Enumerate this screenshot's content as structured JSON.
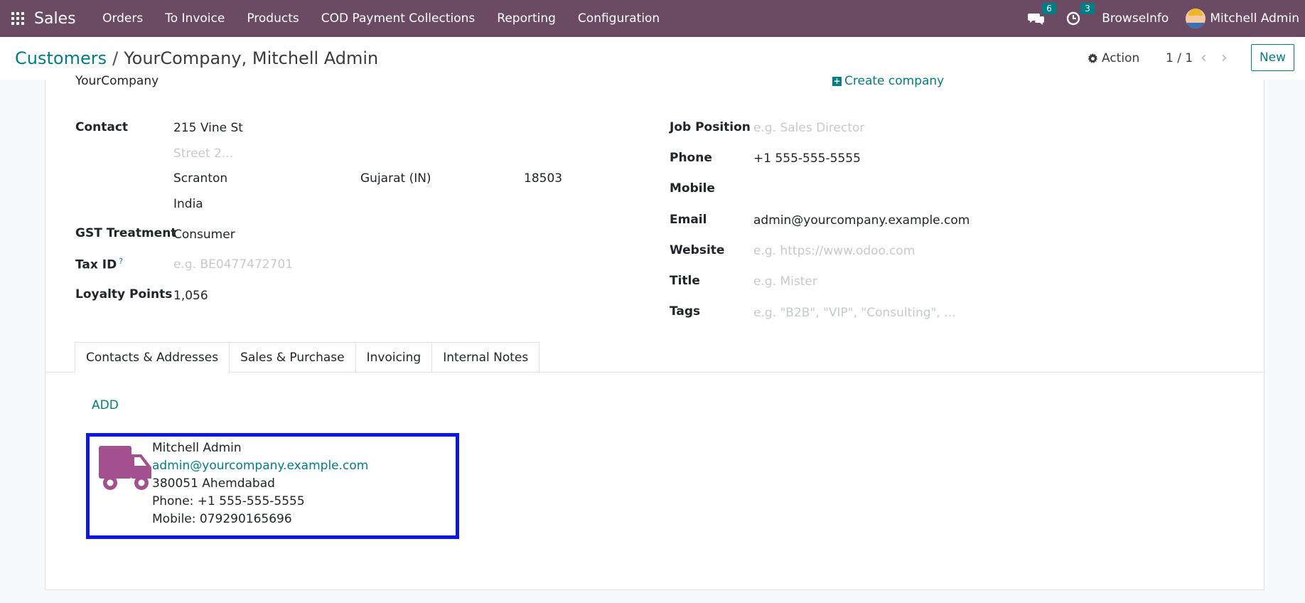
{
  "navbar": {
    "app_name": "Sales",
    "menu": [
      "Orders",
      "To Invoice",
      "Products",
      "COD Payment Collections",
      "Reporting",
      "Configuration"
    ],
    "messages_count": "6",
    "activities_count": "3",
    "company": "BrowseInfo",
    "user": "Mitchell Admin"
  },
  "control": {
    "breadcrumb_parent": "Customers",
    "breadcrumb_sep": "/",
    "breadcrumb_current": "YourCompany, Mitchell Admin",
    "action_label": "Action",
    "pager": "1 / 1",
    "new_label": "New"
  },
  "form": {
    "company_name": "YourCompany",
    "create_company": "Create company",
    "contact_label": "Contact",
    "street": "215 Vine St",
    "street2_placeholder": "Street 2...",
    "city": "Scranton",
    "state": "Gujarat (IN)",
    "zip": "18503",
    "country": "India",
    "gst_label": "GST Treatment",
    "gst_value": "Consumer",
    "taxid_label": "Tax ID",
    "taxid_help": "?",
    "taxid_placeholder": "e.g. BE0477472701",
    "loyalty_label": "Loyalty Points",
    "loyalty_value": "1,056",
    "job_label": "Job Position",
    "job_placeholder": "e.g. Sales Director",
    "phone_label": "Phone",
    "phone_value": "+1 555-555-5555",
    "mobile_label": "Mobile",
    "email_label": "Email",
    "email_value": "admin@yourcompany.example.com",
    "website_label": "Website",
    "website_placeholder": "e.g. https://www.odoo.com",
    "title_label": "Title",
    "title_placeholder": "e.g. Mister",
    "tags_label": "Tags",
    "tags_placeholder": "e.g. \"B2B\", \"VIP\", \"Consulting\", ..."
  },
  "tabs": [
    "Contacts & Addresses",
    "Sales & Purchase",
    "Invoicing",
    "Internal Notes"
  ],
  "contacts": {
    "add_label": "ADD",
    "card": {
      "name": "Mitchell Admin",
      "email": "admin@yourcompany.example.com",
      "address": "380051 Ahemdabad",
      "phone": "Phone: +1 555-555-5555",
      "mobile": "Mobile: 079290165696",
      "icon_color": "#a2508e"
    }
  },
  "colors": {
    "navbar": "#6b4a63",
    "accent": "#017e84",
    "highlight_border": "#0a17e8"
  }
}
